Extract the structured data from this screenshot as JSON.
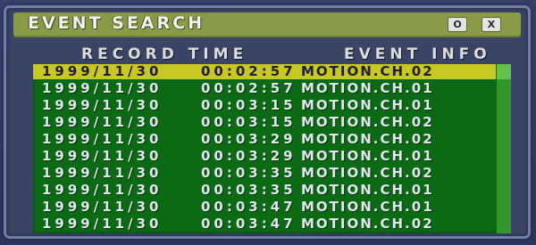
{
  "window": {
    "title": "EVENT SEARCH",
    "option_button": "O",
    "close_button": "X"
  },
  "columns": {
    "record_time": "RECORD TIME",
    "event_info": "EVENT INFO"
  },
  "events": [
    {
      "date": "1999/11/30",
      "time": "00:02:57",
      "event": "MOTION.CH.02",
      "selected": true
    },
    {
      "date": "1999/11/30",
      "time": "00:02:57",
      "event": "MOTION.CH.01",
      "selected": false
    },
    {
      "date": "1999/11/30",
      "time": "00:03:15",
      "event": "MOTION.CH.01",
      "selected": false
    },
    {
      "date": "1999/11/30",
      "time": "00:03:15",
      "event": "MOTION.CH.02",
      "selected": false
    },
    {
      "date": "1999/11/30",
      "time": "00:03:29",
      "event": "MOTION.CH.02",
      "selected": false
    },
    {
      "date": "1999/11/30",
      "time": "00:03:29",
      "event": "MOTION.CH.01",
      "selected": false
    },
    {
      "date": "1999/11/30",
      "time": "00:03:35",
      "event": "MOTION.CH.02",
      "selected": false
    },
    {
      "date": "1999/11/30",
      "time": "00:03:35",
      "event": "MOTION.CH.01",
      "selected": false
    },
    {
      "date": "1999/11/30",
      "time": "00:03:47",
      "event": "MOTION.CH.01",
      "selected": false
    },
    {
      "date": "1999/11/30",
      "time": "00:03:47",
      "event": "MOTION.CH.02",
      "selected": false
    }
  ],
  "colors": {
    "titlebar": "#8a9b48",
    "list_background": "#0c6a14",
    "selected_row": "#c8c824"
  }
}
